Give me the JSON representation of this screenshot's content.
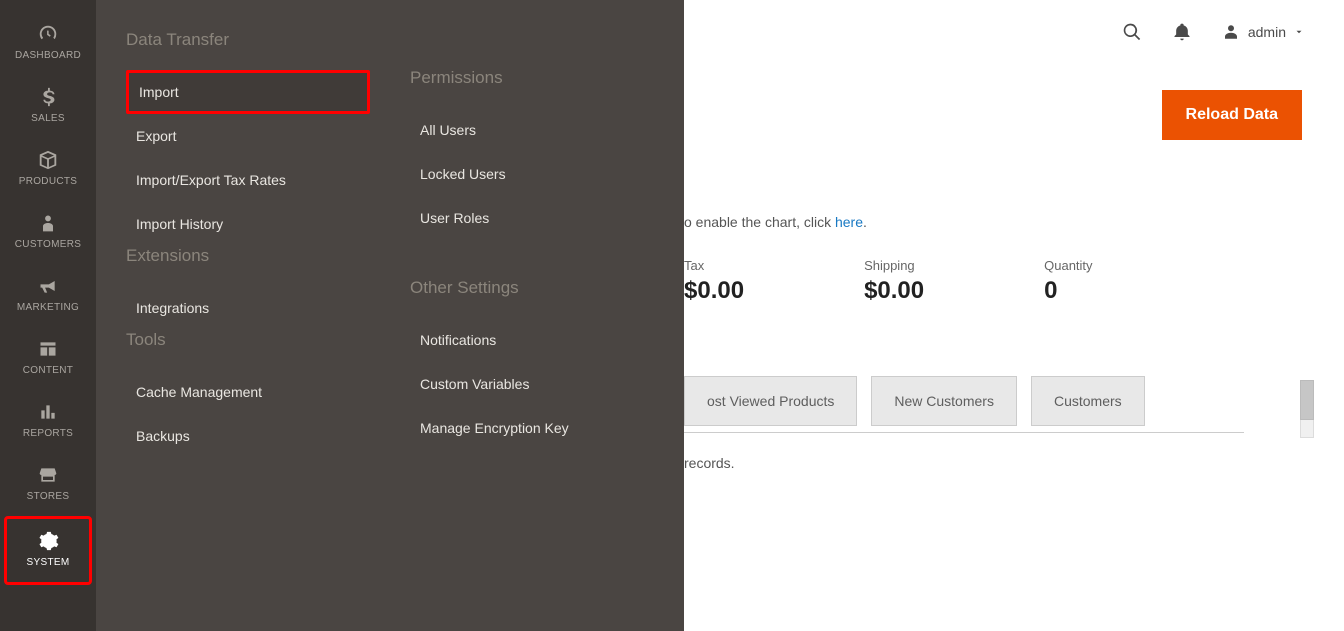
{
  "sidebar": {
    "items": [
      {
        "label": "DASHBOARD"
      },
      {
        "label": "SALES"
      },
      {
        "label": "PRODUCTS"
      },
      {
        "label": "CUSTOMERS"
      },
      {
        "label": "MARKETING"
      },
      {
        "label": "CONTENT"
      },
      {
        "label": "REPORTS"
      },
      {
        "label": "STORES"
      },
      {
        "label": "SYSTEM"
      }
    ]
  },
  "submenu": {
    "col1": {
      "group1_heading": "Data Transfer",
      "group1_items": [
        "Import",
        "Export",
        "Import/Export Tax Rates",
        "Import History"
      ],
      "group2_heading": "Extensions",
      "group2_items": [
        "Integrations"
      ],
      "group3_heading": "Tools",
      "group3_items": [
        "Cache Management",
        "Backups"
      ]
    },
    "col2": {
      "group1_heading": "Permissions",
      "group1_items": [
        "All Users",
        "Locked Users",
        "User Roles"
      ],
      "group2_heading": "Other Settings",
      "group2_items": [
        "Notifications",
        "Custom Variables",
        "Manage Encryption Key"
      ]
    }
  },
  "topbar": {
    "admin_label": "admin"
  },
  "page": {
    "reload_label": "Reload Data",
    "chart_prefix": "o enable the chart, click ",
    "chart_link": "here",
    "chart_suffix": "."
  },
  "stats": [
    {
      "label": "Tax",
      "value": "$0.00"
    },
    {
      "label": "Shipping",
      "value": "$0.00"
    },
    {
      "label": "Quantity",
      "value": "0"
    }
  ],
  "tabs": [
    "ost Viewed Products",
    "New Customers",
    "Customers"
  ],
  "records_text": "records."
}
